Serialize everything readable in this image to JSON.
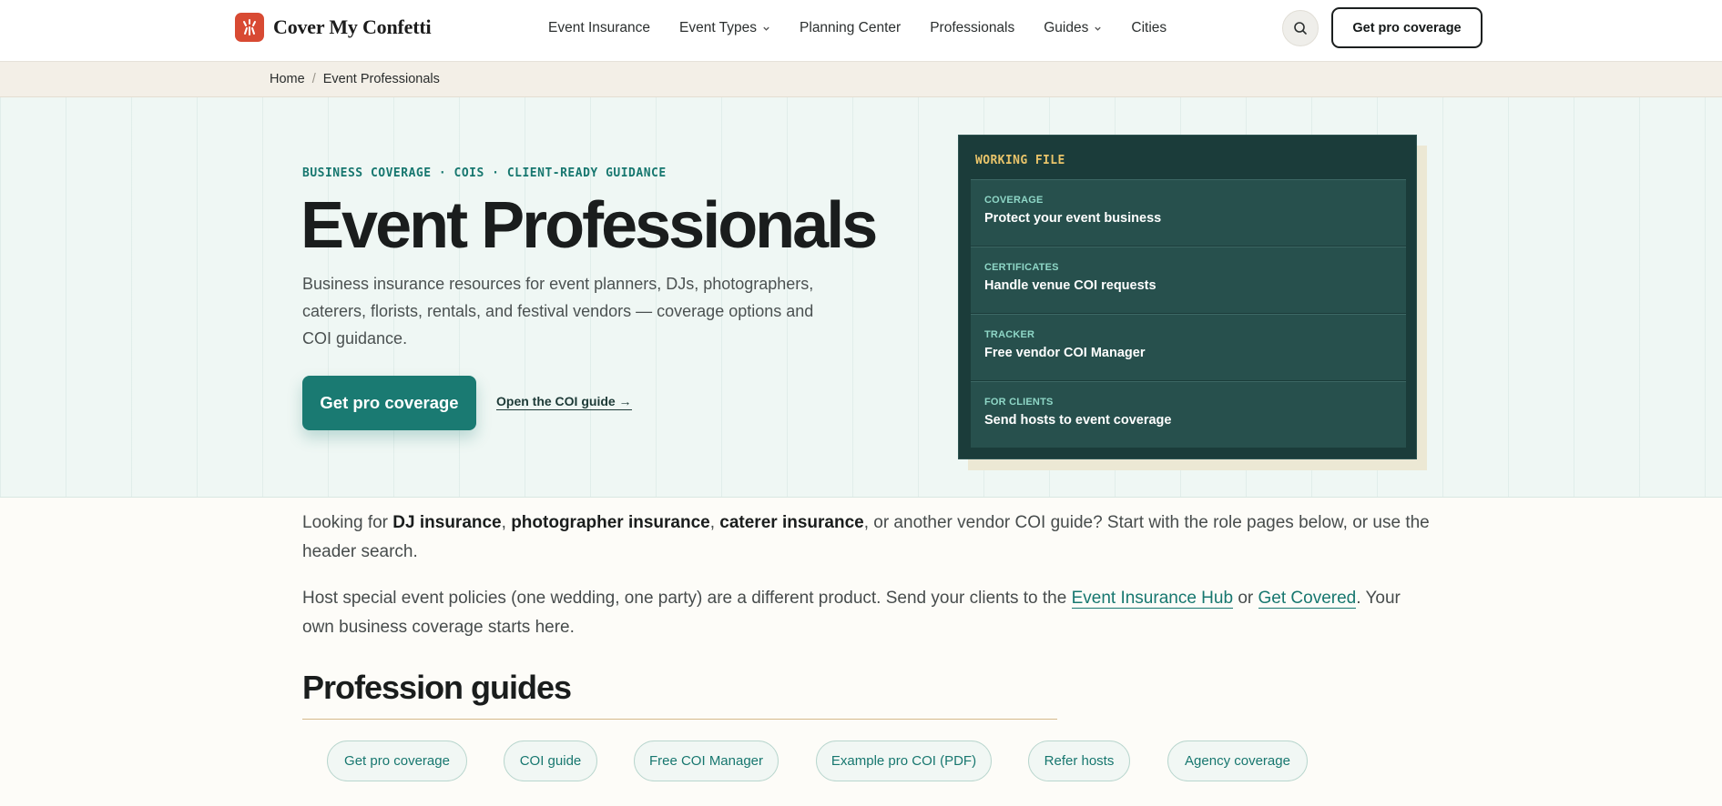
{
  "header": {
    "logo_text": "Cover My Confetti",
    "nav": [
      {
        "label": "Event Insurance"
      },
      {
        "label": "Event Types"
      },
      {
        "label": "Planning Center"
      },
      {
        "label": "Professionals"
      },
      {
        "label": "Guides"
      },
      {
        "label": "Cities"
      }
    ],
    "cta_label": "Get pro coverage"
  },
  "breadcrumb": {
    "home": "Home",
    "separator": "/",
    "current": "Event Professionals"
  },
  "hero": {
    "eyebrow": "BUSINESS COVERAGE · COIS · CLIENT-READY GUIDANCE",
    "title": "Event Professionals",
    "description": "Business insurance resources for event planners, DJs, photographers, caterers, florists, rentals, and festival vendors — coverage options and COI guidance.",
    "cta_label": "Get pro coverage",
    "link_label": "Open the COI guide →"
  },
  "panel": {
    "heading": "WORKING FILE",
    "rows": [
      {
        "label": "COVERAGE",
        "title": "Protect your event business"
      },
      {
        "label": "CERTIFICATES",
        "title": "Handle venue COI requests"
      },
      {
        "label": "TRACKER",
        "title": "Free vendor COI Manager"
      },
      {
        "label": "FOR CLIENTS",
        "title": "Send hosts to event coverage"
      }
    ]
  },
  "intro": {
    "p1_a": "Looking for ",
    "p1_b1": "DJ insurance",
    "p1_c1": ", ",
    "p1_b2": "photographer insurance",
    "p1_c2": ", ",
    "p1_b3": "caterer insurance",
    "p1_d": ", or another vendor COI guide? Start with the role pages below, or use the header search.",
    "p2_a": "Host special event policies (one wedding, one party) are a different product. Send your clients to the ",
    "p2_link1": "Event Insurance Hub",
    "p2_b": " or ",
    "p2_link2": "Get Covered",
    "p2_c": ". Your own business coverage starts here."
  },
  "section": {
    "title": "Profession guides"
  },
  "quick_links": [
    {
      "label": "Get pro coverage"
    },
    {
      "label": "COI guide"
    },
    {
      "label": "Free COI Manager"
    },
    {
      "label": "Example pro COI (PDF)"
    },
    {
      "label": "Refer hosts"
    },
    {
      "label": "Agency coverage"
    }
  ],
  "colors": {
    "brand_teal": "#1a7a72",
    "logo_red": "#d84a33",
    "panel_dark": "#1b3c3a",
    "panel_heading": "#e9c46a"
  }
}
